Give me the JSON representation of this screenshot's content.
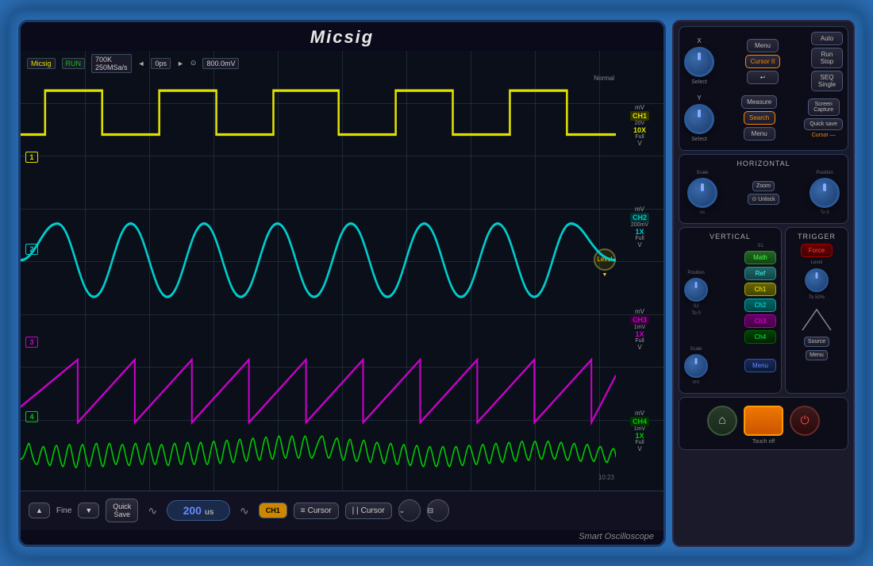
{
  "app": {
    "brand": "Micsig",
    "subtitle": "Smart Oscilloscope",
    "status": "RUN"
  },
  "screen": {
    "timebase": "700K\n250MSa/s",
    "time_pos": "0ps",
    "trigger_level": "800.0mV",
    "normal_label": "Normal",
    "timestamp": "10:23",
    "title": "Micsig"
  },
  "channels": [
    {
      "id": "CH1",
      "voltage": "20V",
      "coupling": "Full",
      "mult": "10X",
      "mv": "mV",
      "v": "V",
      "color": "#e0e000"
    },
    {
      "id": "CH2",
      "voltage": "200mV",
      "coupling": "Full",
      "mult": "1X",
      "mv": "mV",
      "v": "V",
      "color": "#00cccc"
    },
    {
      "id": "CH3",
      "voltage": "1mV",
      "coupling": "Full",
      "mult": "1X",
      "mv": "mV",
      "v": "V",
      "color": "#cc00cc"
    },
    {
      "id": "CH4",
      "voltage": "1mV",
      "coupling": "Full",
      "mult": "1X",
      "mv": "mV",
      "v": "V",
      "color": "#00cc00"
    }
  ],
  "toolbar": {
    "fine_label": "Fine",
    "quick_save_label": "Quick\nSave",
    "time_value": "200",
    "time_unit": "us",
    "cursor_label": "Cursor",
    "cursor2_label": "Cursor"
  },
  "controls": {
    "top_section": {
      "x_label": "X",
      "y_label": "Y",
      "select_label": "Select",
      "buttons": [
        "Menu",
        "Cursor II",
        "Auto",
        "Run\nStop",
        "SEQ\nSingle",
        "Screen\nCapture",
        "Quick save"
      ],
      "cursor_menu": "Menu",
      "cursor_eq": "Cursor —",
      "measure": "Measure",
      "search": "Search"
    },
    "horizontal": {
      "title": "Horizontal",
      "scale_label": "Scale",
      "position_label": "Position",
      "ns_label": "ns",
      "zoom_label": "Zoom",
      "unlock_label": "⊙ Unlock",
      "to5_label": "To 5"
    },
    "vertical": {
      "title": "Vertical",
      "position_label": "Position",
      "scale_label": "Scale",
      "s1_label": "S1",
      "s2_label": "S2",
      "to0_label": "To 0",
      "mv_label": "mV",
      "buttons": [
        "Math",
        "Ref",
        "Ch1",
        "Ch2",
        "Ch3",
        "Ch4",
        "Menu"
      ]
    },
    "trigger": {
      "title": "Trigger",
      "force_label": "Force",
      "level_label": "Level",
      "to50_label": "To 50%",
      "source_label": "Source",
      "menu_label": "Menu"
    },
    "bottom": {
      "touch_off": "Touch off"
    }
  }
}
